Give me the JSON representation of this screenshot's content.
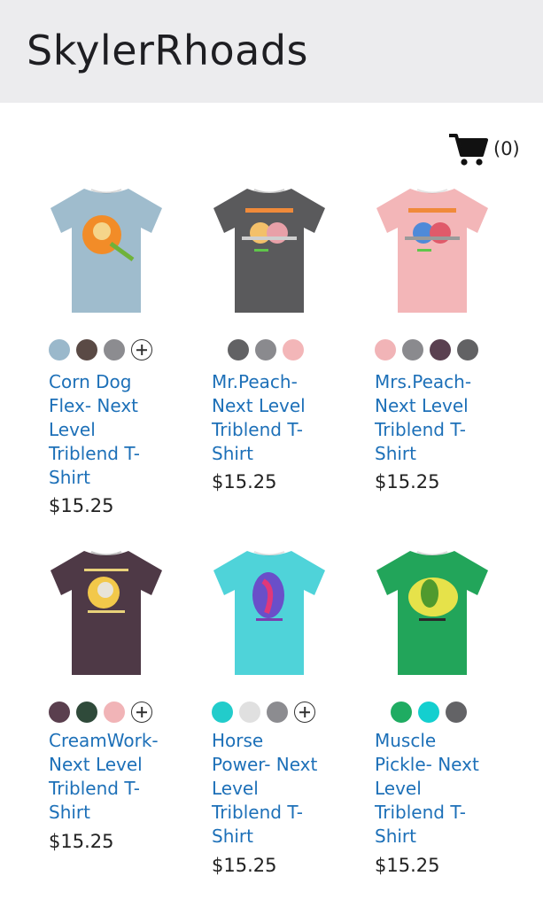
{
  "store": {
    "title": "SkylerRhoads"
  },
  "cart": {
    "count_label": "(0)"
  },
  "products": [
    {
      "name": "Corn Dog Flex- Next Level Triblend T-Shirt",
      "name_lines": [
        "Corn Dog",
        "Flex- Next",
        "Level",
        "Triblend T-",
        "Shirt"
      ],
      "price": "$15.25",
      "shirt_color": "#9fbccd",
      "swatches": [
        "#9ab8cb",
        "#5a4a45",
        "#8c8c90"
      ],
      "more_colors": true
    },
    {
      "name": "Mr.Peach-Next Level Triblend T-Shirt",
      "name_lines": [
        "Mr.Peach-",
        "Next Level",
        "Triblend T-",
        "Shirt"
      ],
      "price": "$15.25",
      "shirt_color": "#5a5a5c",
      "swatches": [
        "#626264",
        "#8a8a8e",
        "#f3b6b8"
      ],
      "more_colors": false
    },
    {
      "name": "Mrs.Peach-Next Level Triblend T-Shirt",
      "name_lines": [
        "Mrs.Peach-",
        "Next Level",
        "Triblend T-",
        "Shirt"
      ],
      "price": "$15.25",
      "shirt_color": "#f3b6b8",
      "swatches": [
        "#f1b4b7",
        "#8a8a8e",
        "#5a4050",
        "#626264"
      ],
      "more_colors": false
    },
    {
      "name": "CreamWork-Next Level Triblend T-Shirt",
      "name_lines": [
        "CreamWork-",
        "Next Level",
        "Triblend T-",
        "Shirt"
      ],
      "price": "$15.25",
      "shirt_color": "#4e3946",
      "swatches": [
        "#5a3f4e",
        "#2f4a3a",
        "#f1b4b7"
      ],
      "more_colors": true
    },
    {
      "name": "Horse Power- Next Level Triblend T-Shirt",
      "name_lines": [
        "Horse",
        "Power- Next",
        "Level",
        "Triblend T-",
        "Shirt"
      ],
      "price": "$15.25",
      "shirt_color": "#4fd3d9",
      "swatches": [
        "#22cccb",
        "#e0e0e0",
        "#8c8c90"
      ],
      "more_colors": true
    },
    {
      "name": "Muscle Pickle- Next Level Triblend T-Shirt",
      "name_lines": [
        "Muscle",
        "Pickle- Next",
        "Level",
        "Triblend T-",
        "Shirt"
      ],
      "price": "$15.25",
      "shirt_color": "#22a55a",
      "swatches": [
        "#1fac62",
        "#14cfcf",
        "#636366"
      ],
      "more_colors": false
    }
  ]
}
